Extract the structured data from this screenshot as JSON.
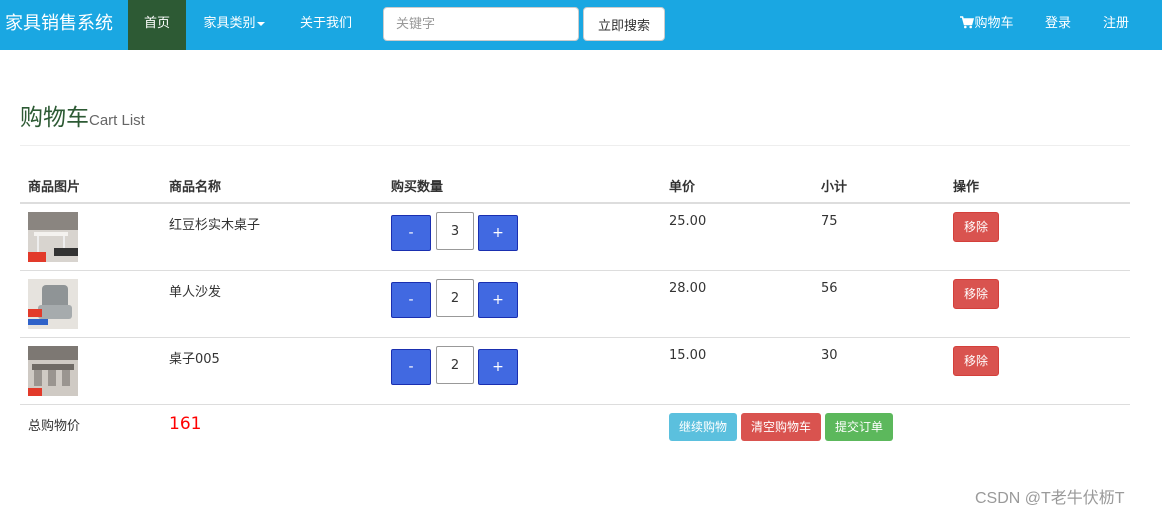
{
  "navbar": {
    "brand": "家具销售系统",
    "home": "首页",
    "categories": "家具类别",
    "about": "关于我们",
    "search_placeholder": "关键字",
    "search_button": "立即搜索",
    "cart": "购物车",
    "login": "登录",
    "register": "注册",
    "bg_color": "#1aa7e2",
    "active_color": "#2d5a34"
  },
  "header": {
    "title": "购物车",
    "subtitle": "Cart List"
  },
  "table": {
    "columns": [
      "商品图片",
      "商品名称",
      "购买数量",
      "单价",
      "小计",
      "操作"
    ],
    "rows": [
      {
        "name": "红豆杉实木桌子",
        "qty": "3",
        "price": "25.00",
        "subtotal": "75",
        "minus": "-",
        "plus": "+",
        "remove": "移除"
      },
      {
        "name": "单人沙发",
        "qty": "2",
        "price": "28.00",
        "subtotal": "56",
        "minus": "-",
        "plus": "+",
        "remove": "移除"
      },
      {
        "name": "桌子005",
        "qty": "2",
        "price": "15.00",
        "subtotal": "30",
        "minus": "-",
        "plus": "+",
        "remove": "移除"
      }
    ]
  },
  "footer_row": {
    "total_label": "总购物价",
    "total_value": "161",
    "continue_button": "继续购物",
    "clear_button": "清空购物车",
    "submit_button": "提交订单"
  },
  "watermark": "CSDN @T老牛伏枥T"
}
